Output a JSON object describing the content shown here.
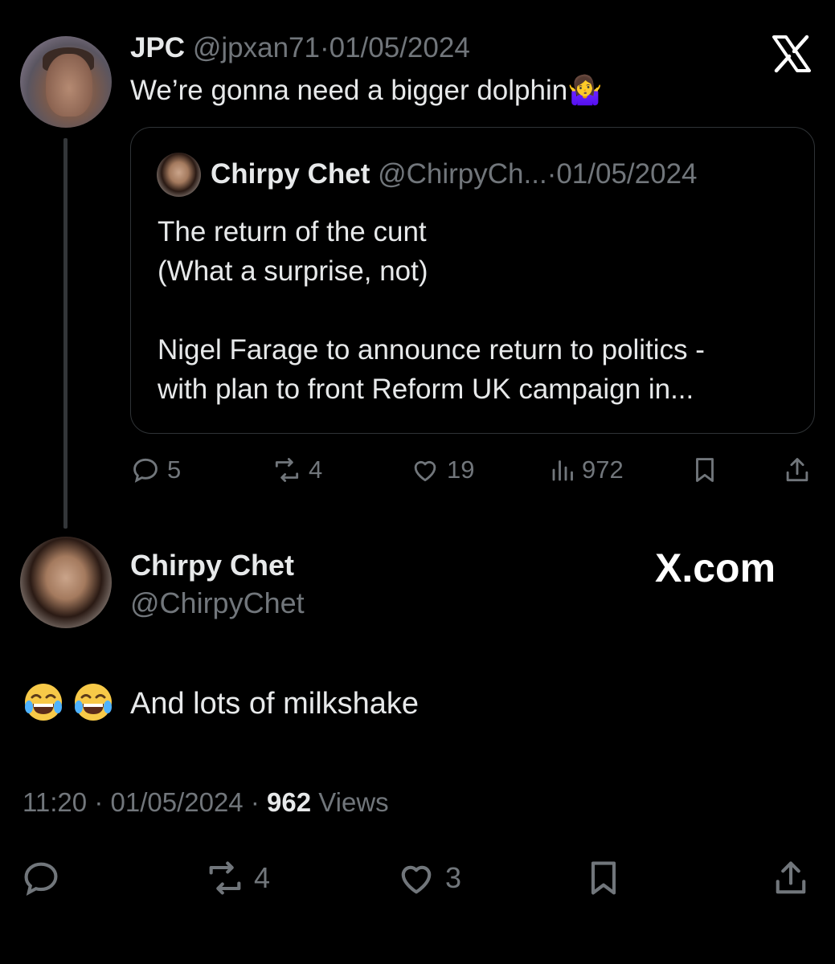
{
  "original_tweet": {
    "name": "JPC",
    "handle": "@jpxan71",
    "date": "01/05/2024",
    "text": "We’re gonna need a bigger dolphin🤷‍♀️",
    "quote": {
      "name": "Chirpy Chet",
      "handle": "@ChirpyCh...",
      "date": "01/05/2024",
      "text": "The return of the cunt\n(What a surprise, not)\n\nNigel Farage to announce return to politics -\nwith plan to front Reform UK campaign in..."
    },
    "actions": {
      "replies": "5",
      "reposts": "4",
      "likes": "19",
      "views": "972"
    },
    "separator": "·"
  },
  "reply": {
    "name": "Chirpy Chet",
    "handle": "@ChirpyChet",
    "text": "And lots of milkshake",
    "emojis": [
      "😂",
      "😂"
    ],
    "time": "11:20",
    "date": "01/05/2024",
    "views_count": "962",
    "views_label": "Views",
    "separator": "·",
    "actions": {
      "reposts": "4",
      "likes": "3"
    }
  },
  "brand": {
    "xcom": "X.com"
  },
  "icons": [
    "x-logo-icon",
    "reply-icon",
    "repost-icon",
    "like-icon",
    "views-icon",
    "bookmark-icon",
    "share-icon",
    "laughing-emoji-icon"
  ],
  "colors": {
    "background": "#000000",
    "text": "#e7e9ea",
    "muted": "#71767b",
    "border": "#2f3336"
  }
}
